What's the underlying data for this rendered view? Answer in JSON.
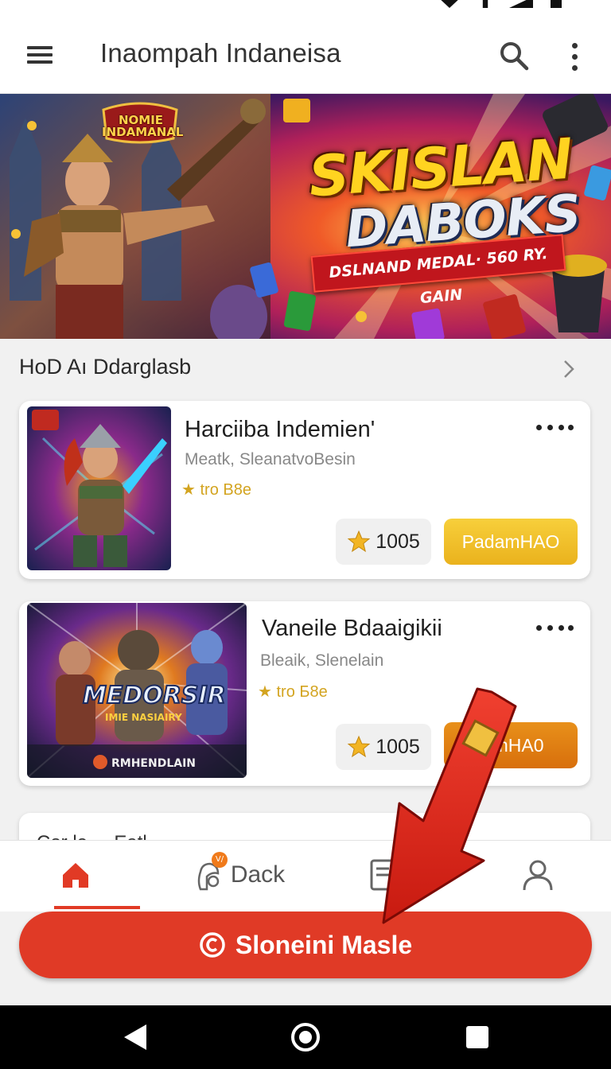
{
  "app_bar": {
    "title": "Inaompah Indaneisa"
  },
  "banner": {
    "badge_line1": "NOMIE",
    "badge_line2": "INDAMANAL",
    "title_line1": "SKISLAN",
    "title_line2": "DABOKS",
    "ribbon": "DSLNAND MEDAL· 560 RY. GAIN"
  },
  "section": {
    "title": "HoD Aı Ddarglasb"
  },
  "games": [
    {
      "title": "Harciiba Indemien'",
      "subtitle": "Meatk, SleanatvoBesin",
      "rating": "★ tro B8e",
      "points": "1005",
      "action_label": "PadamHAO"
    },
    {
      "title": "Vaneile Bdaaigikii",
      "subtitle": "Bleaik, Slenelain",
      "rating": "★ tro Б8e",
      "points": "1005",
      "action_label": "...mHA0",
      "thumb_text1": "MEDORSIR",
      "thumb_text2": "IMIE NASIAIRY",
      "thumb_text3": "RMHENDLAIN"
    }
  ],
  "partial_card": {
    "title": "Cor le ... Eatl"
  },
  "bottom_nav": {
    "items": [
      {
        "label": ""
      },
      {
        "label": "Dack",
        "badge": "V/"
      },
      {
        "label": ""
      },
      {
        "label": ""
      }
    ]
  },
  "cta": {
    "label": "Sloneini Masle"
  },
  "colors": {
    "accent": "#e03a26",
    "gold_button": "#eab21d",
    "orange_button": "#d86f0c",
    "rating": "#d3a420"
  }
}
